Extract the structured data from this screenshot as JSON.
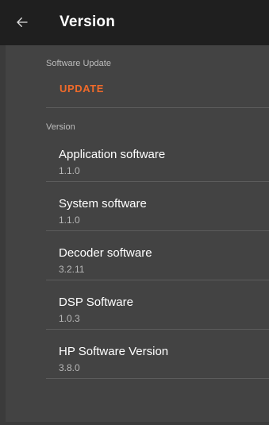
{
  "header": {
    "title": "Version",
    "back_icon": "arrow-left-icon"
  },
  "software_update": {
    "section_label": "Software Update",
    "update_label": "UPDATE"
  },
  "version": {
    "section_label": "Version",
    "items": [
      {
        "title": "Application software",
        "value": "1.1.0"
      },
      {
        "title": "System software",
        "value": "1.1.0"
      },
      {
        "title": "Decoder software",
        "value": "3.2.11"
      },
      {
        "title": "DSP Software",
        "value": "1.0.3"
      },
      {
        "title": "HP Software Version",
        "value": "3.8.0"
      }
    ]
  },
  "colors": {
    "app_bar": "#1f1f1f",
    "background": "#434343",
    "accent": "#f06a2a",
    "primary_text": "#ffffff",
    "secondary_text": "#b8b8b8"
  }
}
